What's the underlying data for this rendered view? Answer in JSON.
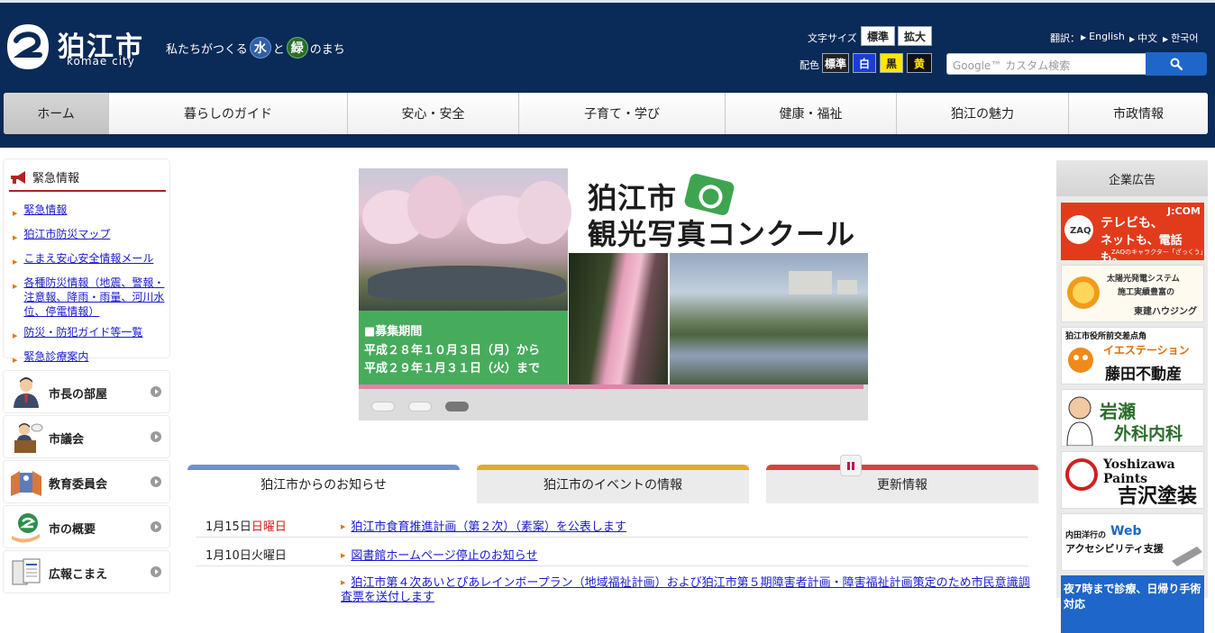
{
  "header": {
    "logo_name": "狛江市",
    "logo_romaji": "komae city",
    "slogan_before": "私たちがつくる",
    "slogan_water": "水",
    "slogan_and": "と",
    "slogan_green": "緑",
    "slogan_after": "のまち",
    "font_size_label": "文字サイズ",
    "font_size_standard": "標準",
    "font_size_large": "拡大",
    "color_label": "配色",
    "color_standard": "標準",
    "color_white": "白",
    "color_black": "黒",
    "color_yellow": "黄",
    "translate_label": "翻訳：",
    "lang_english": "English",
    "lang_chinese": "中文",
    "lang_korean": "한국어",
    "search_placeholder": "Google™ カスタム検索"
  },
  "nav": {
    "items": [
      "ホーム",
      "暮らしのガイド",
      "安心・安全",
      "子育て・学び",
      "健康・福祉",
      "狛江の魅力",
      "市政情報"
    ],
    "active": "ホーム"
  },
  "emergency": {
    "title": "緊急情報",
    "links": [
      "緊急情報",
      "狛江市防災マップ",
      "こまえ安心安全情報メール",
      "各種防災情報（地震、警報・注意報、降雨・雨量、河川水位、停電情報）",
      "防災・防犯ガイド等一覧",
      "緊急診療案内"
    ]
  },
  "side_menu": [
    "市長の部屋",
    "市議会",
    "教育委員会",
    "市の概要",
    "広報こまえ"
  ],
  "slideshow": {
    "title_line1": "狛江市",
    "title_line2": "観光写真コンクール",
    "period_title": "■募集期間",
    "period_line1": "平成２８年１０月３日（月）から",
    "period_line2": "平成２９年１月３１日（火）まで",
    "slide_count": 3,
    "active_slide": 3
  },
  "tabs": {
    "items": [
      "狛江市からのお知らせ",
      "狛江市のイベントの情報",
      "更新情報"
    ],
    "selected": "狛江市からのお知らせ",
    "colors": [
      "#6f8fd3",
      "#e5a92f",
      "#d2463a"
    ]
  },
  "news": [
    {
      "date": "1月15日",
      "weekday": "日曜日",
      "title": "狛江市食育推進計画（第２次）（素案）を公表します"
    },
    {
      "date": "1月10日",
      "weekday": "火曜日",
      "title": "図書館ホームページ停止のお知らせ"
    },
    {
      "date": "",
      "weekday": "",
      "title": "狛江市第４次あいとぴあレインボープラン（地域福祉計画）および狛江市第５期障害者計画・障害福祉計画策定のため市民意識調査票を送付します"
    }
  ],
  "ads": {
    "title": "企業広告",
    "items": [
      {
        "line1": "テレビも、",
        "line2": "ネットも、電話も。",
        "sub": "ZAQのキャラクター「ざっくう」",
        "brand": "J:COM"
      },
      {
        "line1": "太陽光発電システム",
        "line2": "施工実績豊富の",
        "brand": "東建ハウジング"
      },
      {
        "line1": "狛江市役所前交差点角",
        "brand": "イエステーション",
        "line2": "藤田不動産"
      },
      {
        "line1": "岩瀬",
        "line2": "外科内科"
      },
      {
        "line1": "Yoshizawa Paints",
        "line2": "吉沢塗装"
      },
      {
        "line1": "内田洋行の",
        "brand": "Web",
        "line2": "アクセシビリティ支援"
      },
      {
        "line1": "夜7時まで診療、日帰り手術対応"
      }
    ]
  }
}
